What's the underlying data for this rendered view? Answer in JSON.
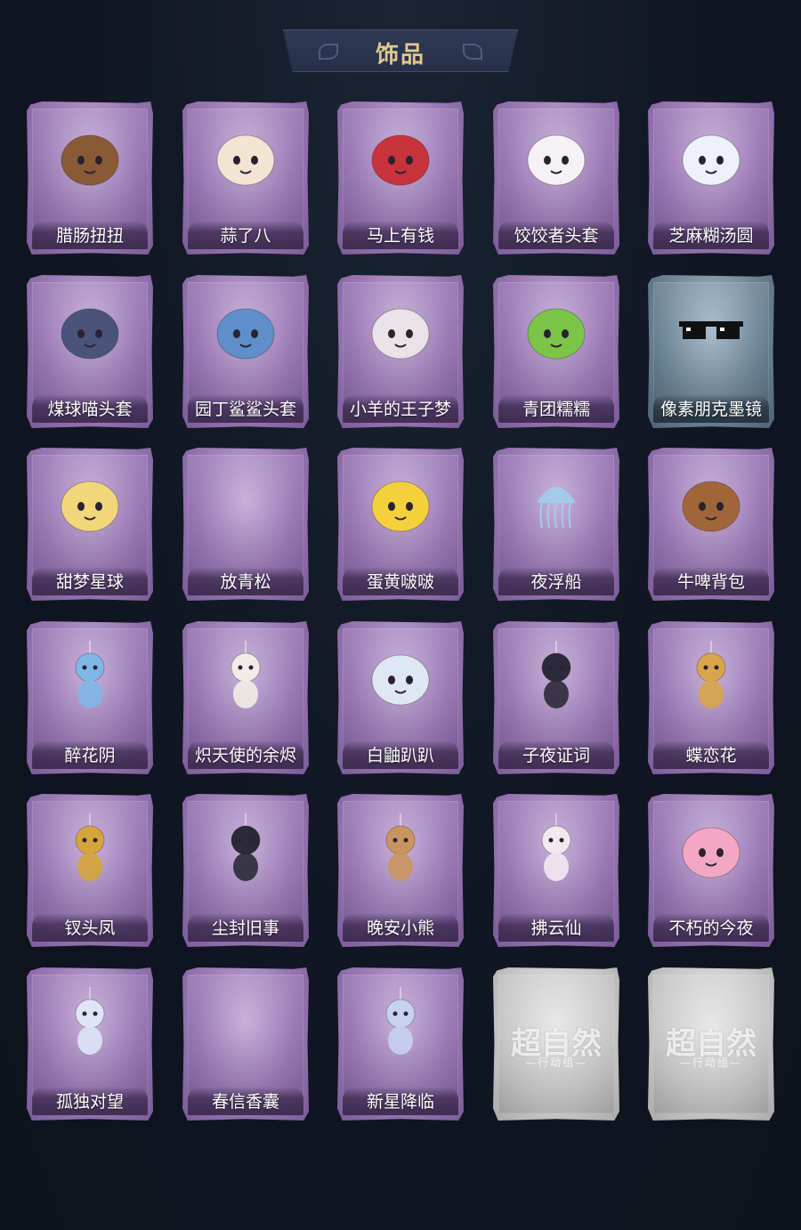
{
  "header": {
    "title": "饰品"
  },
  "colors": {
    "background": "#101622",
    "title_gold": "#e3c78a",
    "card_purple": "#9b79b5",
    "card_blue": "#6f8799",
    "card_grey": "#c8c8c8"
  },
  "items": [
    {
      "label": "腊肠扭扭",
      "rarity": "purple",
      "icon": "sausage-dog-icon",
      "color": "#8a5a34"
    },
    {
      "label": "蒜了八",
      "rarity": "purple",
      "icon": "garlic-icon",
      "color": "#f0e6d2"
    },
    {
      "label": "马上有钱",
      "rarity": "purple",
      "icon": "horse-head-icon",
      "color": "#c8323a"
    },
    {
      "label": "饺饺者头套",
      "rarity": "purple",
      "icon": "dumpling-icon",
      "color": "#f5f2f6"
    },
    {
      "label": "芝麻糊汤圆",
      "rarity": "purple",
      "icon": "tangyuan-icon",
      "color": "#eef0fa"
    },
    {
      "label": "煤球喵头套",
      "rarity": "purple",
      "icon": "cat-head-icon",
      "color": "#4a5478"
    },
    {
      "label": "园丁鲨鲨头套",
      "rarity": "purple",
      "icon": "shark-head-icon",
      "color": "#5e8fc8"
    },
    {
      "label": "小羊的王子梦",
      "rarity": "purple",
      "icon": "sheep-crown-icon",
      "color": "#e9e2e6"
    },
    {
      "label": "青团糯糯",
      "rarity": "purple",
      "icon": "green-rice-ball-icon",
      "color": "#7cc548"
    },
    {
      "label": "像素朋克墨镜",
      "rarity": "blue",
      "icon": "pixel-sunglasses-icon",
      "color": "#111111"
    },
    {
      "label": "甜梦星球",
      "rarity": "purple",
      "icon": "moon-dream-icon",
      "color": "#f2d77a"
    },
    {
      "label": "放青松",
      "rarity": "purple",
      "icon": "empty-slot-icon",
      "color": "#9b79b5"
    },
    {
      "label": "蛋黄啵啵",
      "rarity": "purple",
      "icon": "chick-egg-icon",
      "color": "#f4d13c"
    },
    {
      "label": "夜浮船",
      "rarity": "purple",
      "icon": "jellyfish-icon",
      "color": "#9ed0ee"
    },
    {
      "label": "牛啤背包",
      "rarity": "purple",
      "icon": "beer-cow-icon",
      "color": "#a0663a"
    },
    {
      "label": "醉花阴",
      "rarity": "purple",
      "icon": "lantern-charm-icon",
      "color": "#7fb7e6"
    },
    {
      "label": "炽天使的余烬",
      "rarity": "purple",
      "icon": "angel-doll-icon",
      "color": "#f1ece6"
    },
    {
      "label": "白鼬趴趴",
      "rarity": "purple",
      "icon": "ferret-icon",
      "color": "#dfe8f2"
    },
    {
      "label": "子夜证词",
      "rarity": "purple",
      "icon": "crow-doll-icon",
      "color": "#2c2a3a"
    },
    {
      "label": "蝶恋花",
      "rarity": "purple",
      "icon": "bell-wreath-icon",
      "color": "#d8a54a"
    },
    {
      "label": "钗头凤",
      "rarity": "purple",
      "icon": "phoenix-crown-doll-icon",
      "color": "#d4a53a"
    },
    {
      "label": "尘封旧事",
      "rarity": "purple",
      "icon": "suit-doll-icon",
      "color": "#2a2a38"
    },
    {
      "label": "晚安小熊",
      "rarity": "purple",
      "icon": "teddy-bear-icon",
      "color": "#c9955e"
    },
    {
      "label": "拂云仙",
      "rarity": "purple",
      "icon": "fairy-doll-icon",
      "color": "#f2e8f0"
    },
    {
      "label": "不朽的今夜",
      "rarity": "purple",
      "icon": "pig-cup-icon",
      "color": "#f2a8c2"
    },
    {
      "label": "孤独对望",
      "rarity": "purple",
      "icon": "ice-doll-icon",
      "color": "#dfe4f6"
    },
    {
      "label": "春信香囊",
      "rarity": "purple",
      "icon": "empty-slot-icon",
      "color": "#9b79b5"
    },
    {
      "label": "新星降临",
      "rarity": "purple",
      "icon": "star-doll-icon",
      "color": "#c6d2ee"
    },
    {
      "label": "",
      "rarity": "grey",
      "icon": "watermark-logo-icon",
      "color": "#ffffff",
      "watermark": "超自然",
      "watermark_sub": "—行动组—"
    },
    {
      "label": "",
      "rarity": "grey",
      "icon": "watermark-logo-icon",
      "color": "#ffffff",
      "watermark": "超自然",
      "watermark_sub": "—行动组—"
    }
  ]
}
